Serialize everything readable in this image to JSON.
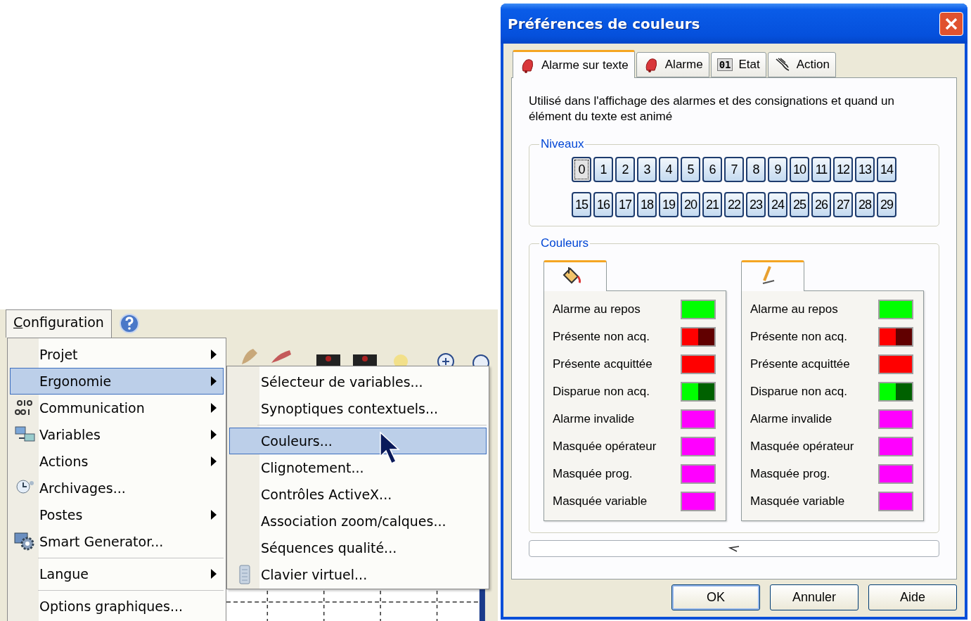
{
  "menubar": {
    "menu": "Configuration",
    "selected": true
  },
  "menu": {
    "items": [
      {
        "label": "Projet",
        "submenu": true,
        "selected": false
      },
      {
        "label": "Ergonomie",
        "submenu": true,
        "selected": true
      },
      {
        "label": "Communication",
        "submenu": true,
        "selected": false,
        "kind": "binary"
      },
      {
        "label": "Variables",
        "submenu": true,
        "selected": false,
        "kind": "network"
      },
      {
        "label": "Actions",
        "submenu": true,
        "selected": false
      },
      {
        "label": "Archivages...",
        "submenu": false,
        "selected": false,
        "kind": "clock"
      },
      {
        "label": "Postes",
        "submenu": true,
        "selected": false
      },
      {
        "label": "Smart Generator...",
        "submenu": false,
        "selected": false,
        "kind": "gear"
      },
      {
        "label": "Langue",
        "submenu": true,
        "selected": false,
        "separator_before": true
      },
      {
        "label": "Options graphiques...",
        "submenu": false,
        "selected": false,
        "separator_before": true
      }
    ]
  },
  "submenu": {
    "items": [
      {
        "label": "Sélecteur de variables...",
        "selected": false
      },
      {
        "label": "Synoptiques contextuels...",
        "selected": false
      },
      {
        "label": "Couleurs...",
        "selected": true,
        "separator_before": true
      },
      {
        "label": "Clignotement...",
        "selected": false
      },
      {
        "label": "Contrôles ActiveX...",
        "selected": false
      },
      {
        "label": "Association zoom/calques...",
        "selected": false
      },
      {
        "label": "Séquences qualité...",
        "selected": false
      },
      {
        "label": "Clavier virtuel...",
        "selected": false,
        "kind": "keyboard"
      }
    ]
  },
  "dialog": {
    "title": "Préférences de couleurs",
    "tabs": [
      {
        "label": "Alarme sur texte",
        "kind": "bell",
        "selected": true
      },
      {
        "label": "Alarme",
        "kind": "bell",
        "selected": false
      },
      {
        "label": "Etat",
        "kind": "badge",
        "badge": "01",
        "selected": false
      },
      {
        "label": "Action",
        "kind": "hand",
        "selected": false
      }
    ],
    "description": "Utilisé dans l'affichage des alarmes et des consignations et quand un élément du texte est animé",
    "levels": {
      "title": "Niveaux",
      "buttons": [
        {
          "label": "0",
          "selected": true
        },
        {
          "label": "1",
          "selected": false
        },
        {
          "label": "2",
          "selected": false
        },
        {
          "label": "3",
          "selected": false
        },
        {
          "label": "4",
          "selected": false
        },
        {
          "label": "5",
          "selected": false
        },
        {
          "label": "6",
          "selected": false
        },
        {
          "label": "7",
          "selected": false
        },
        {
          "label": "8",
          "selected": false
        },
        {
          "label": "9",
          "selected": false
        },
        {
          "label": "10",
          "selected": false
        },
        {
          "label": "11",
          "selected": false
        },
        {
          "label": "12",
          "selected": false
        },
        {
          "label": "13",
          "selected": false
        },
        {
          "label": "14",
          "selected": false
        },
        {
          "label": "15",
          "selected": false
        },
        {
          "label": "16",
          "selected": false
        },
        {
          "label": "17",
          "selected": false
        },
        {
          "label": "18",
          "selected": false
        },
        {
          "label": "19",
          "selected": false
        },
        {
          "label": "20",
          "selected": false
        },
        {
          "label": "21",
          "selected": false
        },
        {
          "label": "22",
          "selected": false
        },
        {
          "label": "23",
          "selected": false
        },
        {
          "label": "24",
          "selected": false
        },
        {
          "label": "25",
          "selected": false
        },
        {
          "label": "26",
          "selected": false
        },
        {
          "label": "27",
          "selected": false
        },
        {
          "label": "28",
          "selected": false
        },
        {
          "label": "29",
          "selected": false
        }
      ]
    },
    "colors": {
      "title": "Couleurs",
      "panels": [
        {
          "kind": "fill",
          "rows": [
            {
              "label": "Alarme au repos",
              "color": "#00ff00",
              "blinking": false
            },
            {
              "label": "Présente non acq.",
              "color": "#ff0000",
              "blinking": true
            },
            {
              "label": "Présente acquittée",
              "color": "#ff0000",
              "blinking": false
            },
            {
              "label": "Disparue non acq.",
              "color": "#00ff00",
              "blinking": true
            },
            {
              "label": "Alarme invalide",
              "color": "#ff00ff",
              "blinking": false
            },
            {
              "label": "Masquée opérateur",
              "color": "#ff00ff",
              "blinking": false
            },
            {
              "label": "Masquée prog.",
              "color": "#ff00ff",
              "blinking": false
            },
            {
              "label": "Masquée variable",
              "color": "#ff00ff",
              "blinking": false
            }
          ]
        },
        {
          "kind": "line",
          "rows": [
            {
              "label": "Alarme au repos",
              "color": "#00ff00",
              "blinking": false
            },
            {
              "label": "Présente non acq.",
              "color": "#ff0000",
              "blinking": true
            },
            {
              "label": "Présente acquittée",
              "color": "#ff0000",
              "blinking": false
            },
            {
              "label": "Disparue non acq.",
              "color": "#00ff00",
              "blinking": true
            },
            {
              "label": "Alarme invalide",
              "color": "#ff00ff",
              "blinking": false
            },
            {
              "label": "Masquée opérateur",
              "color": "#ff00ff",
              "blinking": false
            },
            {
              "label": "Masquée prog.",
              "color": "#ff00ff",
              "blinking": false
            },
            {
              "label": "Masquée variable",
              "color": "#ff00ff",
              "blinking": false
            }
          ]
        }
      ]
    },
    "buttons": [
      "OK",
      "Annuler",
      "Aide"
    ]
  }
}
